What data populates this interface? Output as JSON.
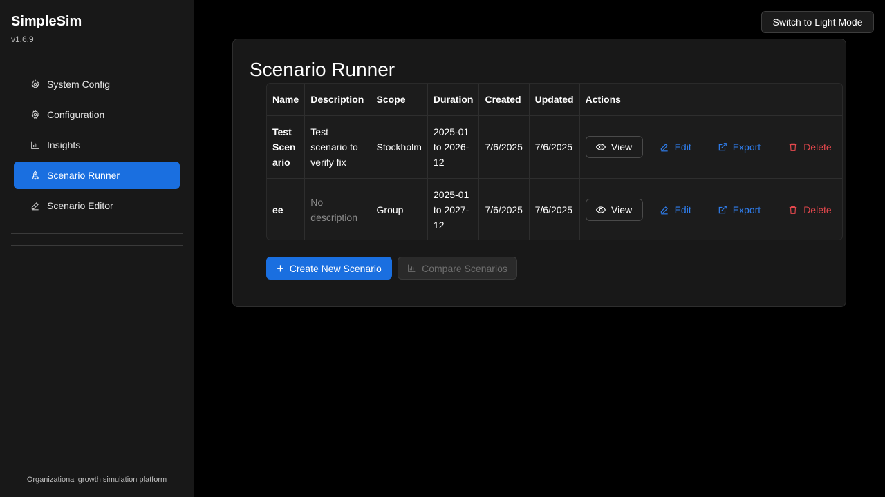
{
  "sidebar": {
    "brand": "SimpleSim",
    "version": "v1.6.9",
    "items": [
      {
        "label": "System Config",
        "icon": "gear-icon"
      },
      {
        "label": "Configuration",
        "icon": "gear-icon"
      },
      {
        "label": "Insights",
        "icon": "bar-chart-icon"
      },
      {
        "label": "Scenario Runner",
        "icon": "rocket-icon",
        "active": true
      },
      {
        "label": "Scenario Editor",
        "icon": "pencil-icon"
      }
    ],
    "footer": "Organizational growth simulation platform"
  },
  "header": {
    "theme_toggle_label": "Switch to Light Mode"
  },
  "main": {
    "title": "Scenario Runner",
    "table": {
      "columns": [
        "Name",
        "Description",
        "Scope",
        "Duration",
        "Created",
        "Updated",
        "Actions"
      ],
      "rows": [
        {
          "name": "Test Scenario",
          "description": "Test scenario to verify fix",
          "scope": "Stockholm",
          "duration": "2025-01 to 2026-12",
          "created": "7/6/2025",
          "updated": "7/6/2025"
        },
        {
          "name": "ee",
          "description": "No description",
          "scope": "Group",
          "duration": "2025-01 to 2027-12",
          "created": "7/6/2025",
          "updated": "7/6/2025"
        }
      ],
      "actions": {
        "view": "View",
        "edit": "Edit",
        "export": "Export",
        "delete": "Delete"
      }
    },
    "create_label": "Create New Scenario",
    "compare_label": "Compare Scenarios"
  },
  "colors": {
    "accent": "#1a6fe0",
    "link": "#2f7ff0",
    "danger": "#e5484d",
    "background": "#000000",
    "panel": "#181818"
  }
}
